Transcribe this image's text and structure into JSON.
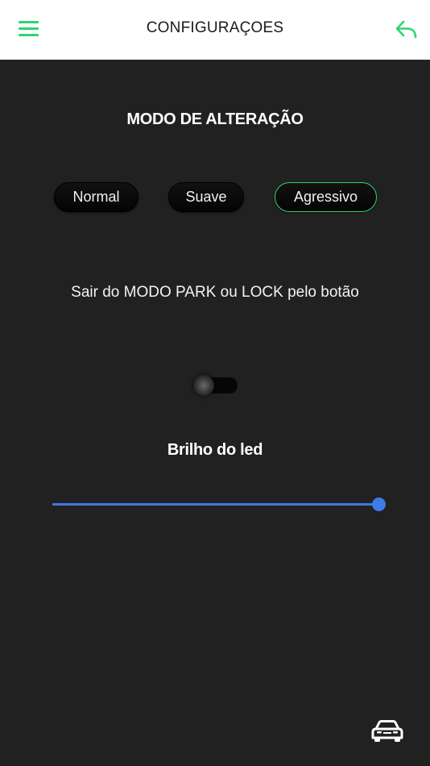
{
  "header": {
    "title": "CONFIGURAÇOES",
    "menu_icon": "hamburger-menu-icon",
    "back_icon": "reply-arrow-icon",
    "accent_color": "#2ed573"
  },
  "mode_section": {
    "title": "MODO DE ALTERAÇÃO",
    "options": [
      {
        "label": "Normal",
        "selected": false
      },
      {
        "label": "Suave",
        "selected": false
      },
      {
        "label": "Agressivo",
        "selected": true
      }
    ]
  },
  "park_section": {
    "label": "Sair do MODO PARK ou LOCK pelo botão",
    "toggle_on": false
  },
  "led_section": {
    "title": "Brilho do led",
    "slider_value": 1.0,
    "slider_color": "#3d7be5"
  },
  "footer": {
    "car_icon": "car-icon"
  }
}
